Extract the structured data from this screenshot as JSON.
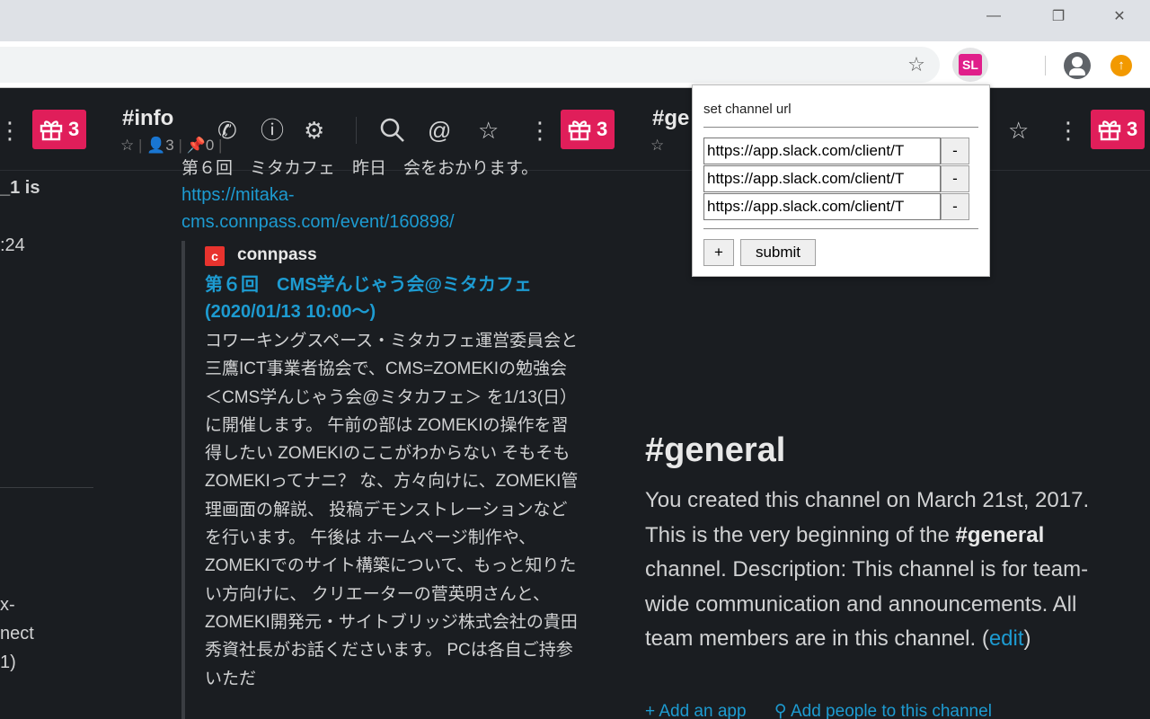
{
  "window": {
    "minimize": "—",
    "restore": "❐",
    "close": "✕"
  },
  "extension": {
    "badge": "SL"
  },
  "slack": {
    "gift_count": "3",
    "channel1": {
      "name": "#info",
      "members": "3",
      "pins": "0"
    },
    "channel2": {
      "name": "#ge"
    },
    "left": {
      "l1": "_1 is",
      "l2": ":24",
      "l3": "x-",
      "l4": "nect",
      "l5": "1)"
    },
    "message": {
      "top_text": "第６回　ミタカフェ　昨日　会をおかります。",
      "url": "https://mitaka-cms.connpass.com/event/160898/",
      "service": "connpass",
      "title": "第６回　CMS学んじゃう会@ミタカフェ (2020/01/13 10:00〜)",
      "body": "コワーキングスペース・ミタカフェ運営委員会と三鷹ICT事業者協会で、CMS=ZOMEKIの勉強会 ＜CMS学んじゃう会@ミタカフェ＞ を1/13(日）に開催します。 午前の部は ZOMEKIの操作を習得したい ZOMEKIのここがわからない そもそも ZOMEKIってナニ？ な、方々向けに、ZOMEKI管理画面の解説、 投稿デモンストレーションなどを行います。 午後は ホームページ制作や、ZOMEKIでのサイト構築について、もっと知りたい方向けに、 クリエーターの菅英明さんと、ZOMEKI開発元・サイトブリッジ株式会社の貴田秀資社長がお話くださいます。 PCは各自ご持参いただ"
    },
    "general": {
      "title": "#general",
      "desc_1": "You created this channel on March 21st, 2017. This is the very beginning of the ",
      "desc_bold": "#general",
      "desc_2": " channel. Description: This channel is for team-wide communication and announcements. All team members are in this channel. (",
      "edit": "edit",
      "desc_3": ")",
      "add_app": "Add an app",
      "add_people": "Add people to this channel"
    }
  },
  "popup": {
    "title": "set channel url",
    "urls": [
      "https://app.slack.com/client/T",
      "https://app.slack.com/client/T",
      "https://app.slack.com/client/T"
    ],
    "remove_label": "-",
    "add_label": "+",
    "submit_label": "submit"
  }
}
